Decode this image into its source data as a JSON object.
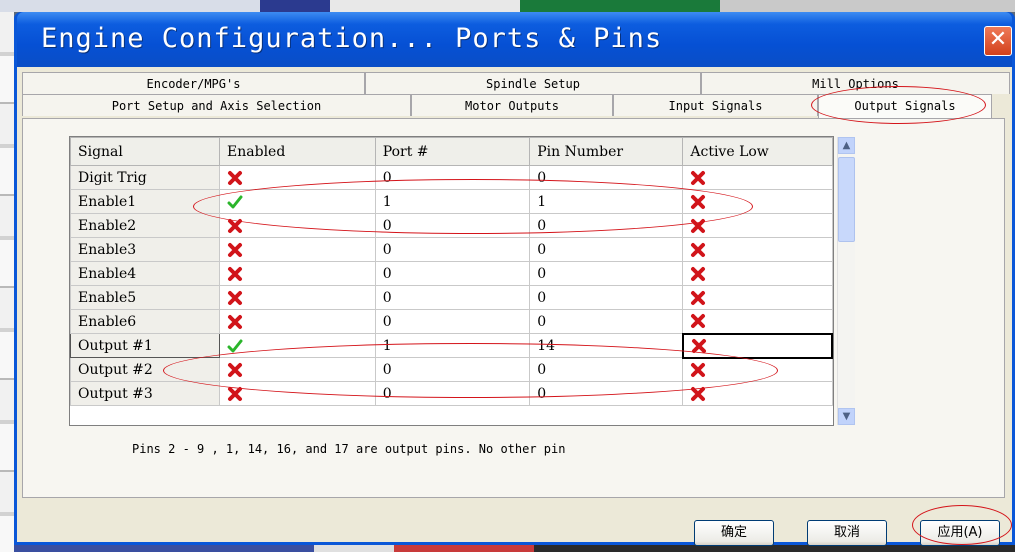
{
  "window": {
    "title": "Engine Configuration... Ports & Pins",
    "close_glyph": "✕"
  },
  "tabs": {
    "row1": [
      "Encoder/MPG's",
      "Spindle Setup",
      "Mill Options"
    ],
    "row2": [
      "Port Setup and Axis Selection",
      "Motor Outputs",
      "Input Signals",
      "Output Signals"
    ],
    "active": "Output Signals"
  },
  "grid": {
    "columns": [
      "Signal",
      "Enabled",
      "Port #",
      "Pin Number",
      "Active Low"
    ],
    "rows": [
      {
        "signal": "Digit  Trig",
        "enabled": false,
        "port": "0",
        "pin": "0",
        "active_low": false
      },
      {
        "signal": "Enable1",
        "enabled": true,
        "port": "1",
        "pin": "1",
        "active_low": false
      },
      {
        "signal": "Enable2",
        "enabled": false,
        "port": "0",
        "pin": "0",
        "active_low": false
      },
      {
        "signal": "Enable3",
        "enabled": false,
        "port": "0",
        "pin": "0",
        "active_low": false
      },
      {
        "signal": "Enable4",
        "enabled": false,
        "port": "0",
        "pin": "0",
        "active_low": false
      },
      {
        "signal": "Enable5",
        "enabled": false,
        "port": "0",
        "pin": "0",
        "active_low": false
      },
      {
        "signal": "Enable6",
        "enabled": false,
        "port": "0",
        "pin": "0",
        "active_low": false
      },
      {
        "signal": "Output #1",
        "enabled": true,
        "port": "1",
        "pin": "14",
        "active_low": false
      },
      {
        "signal": "Output #2",
        "enabled": false,
        "port": "0",
        "pin": "0",
        "active_low": false
      },
      {
        "signal": "Output #3",
        "enabled": false,
        "port": "0",
        "pin": "0",
        "active_low": false
      }
    ]
  },
  "note": "Pins 2 - 9 , 1, 14, 16, and 17 are output pins. No  other pin",
  "buttons": {
    "ok": "确定",
    "cancel": "取消",
    "apply": "应用(A)"
  },
  "icons": {
    "enabled": "green-check-icon",
    "disabled": "red-x-icon",
    "scroll_up": "▲",
    "scroll_down": "▼"
  },
  "colors": {
    "title_bar": "#0a57d8",
    "close": "#d2411c",
    "annotation": "#d4141a",
    "check": "#2bb52b",
    "cross": "#d1141a"
  }
}
